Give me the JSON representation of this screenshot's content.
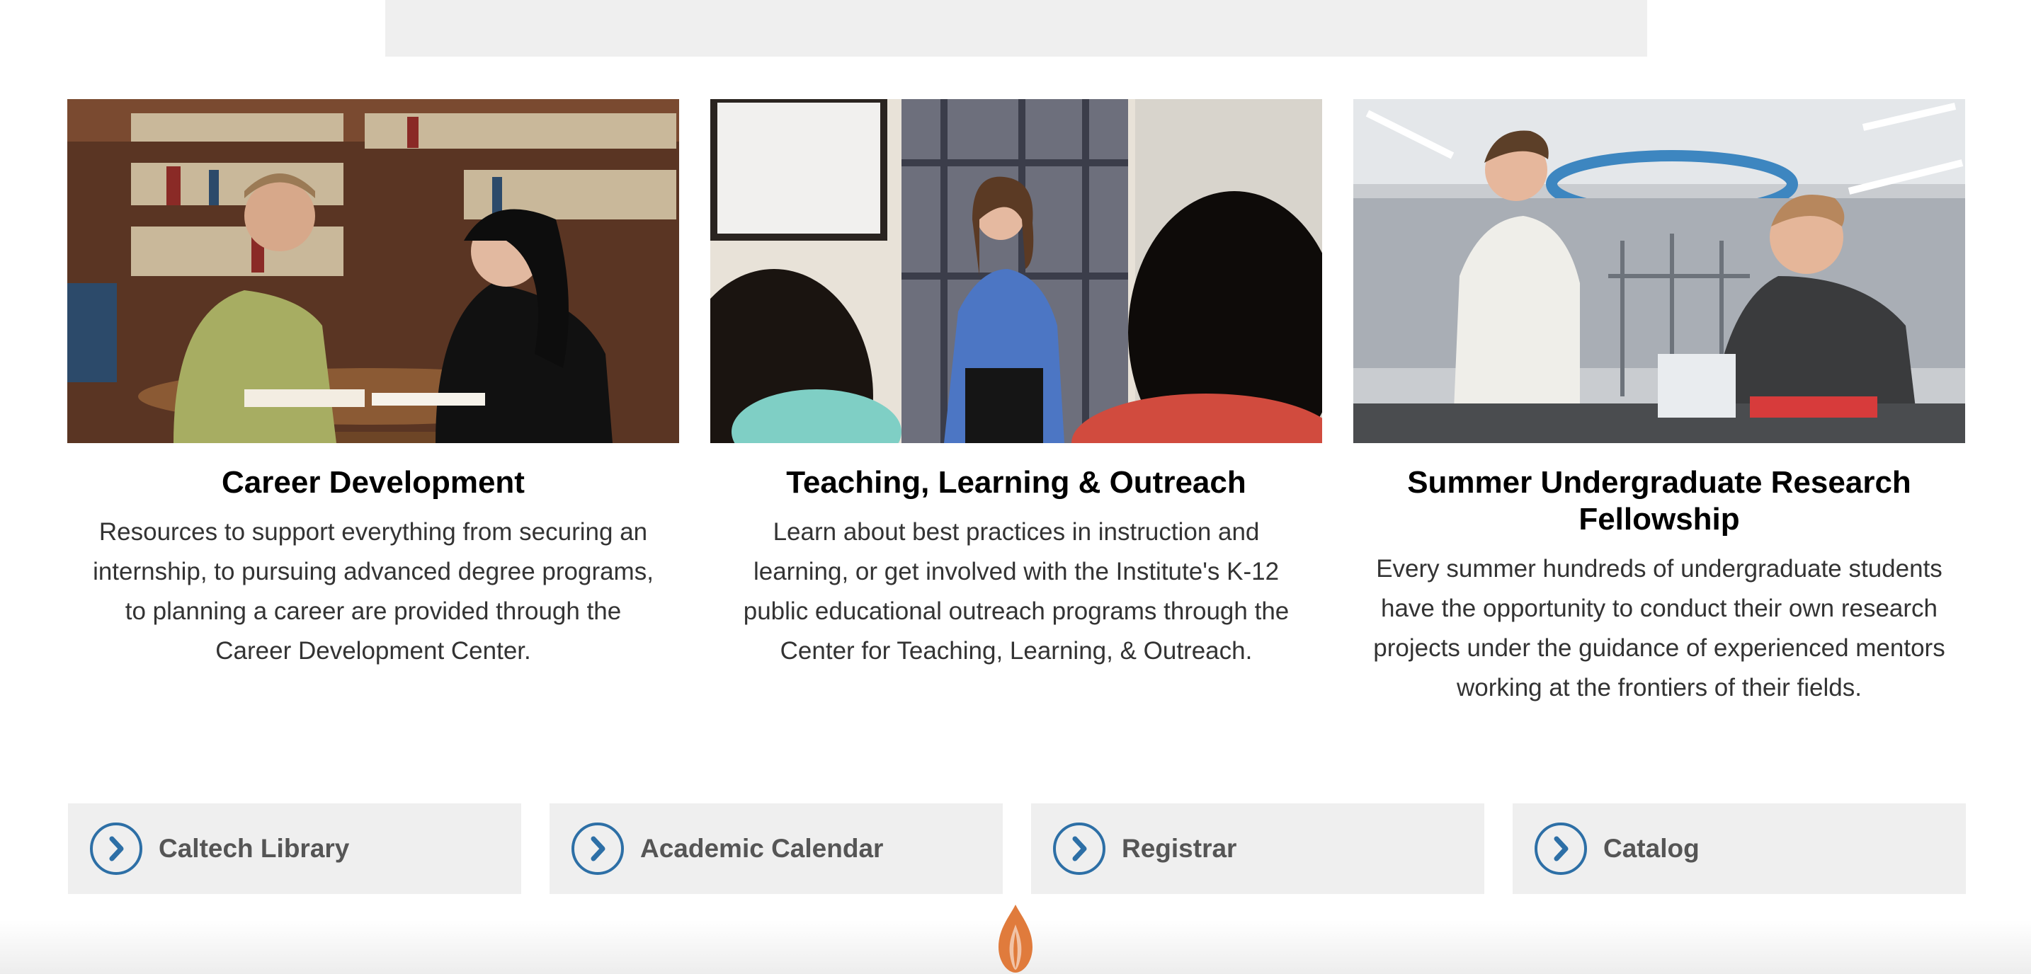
{
  "cards": [
    {
      "title": "Career Development",
      "description": "Resources to support everything from securing an internship, to pursuing advanced degree programs, to planning a career are provided through the Career Development Center."
    },
    {
      "title": "Teaching, Learning & Outreach",
      "description": "Learn about best practices in instruction and learning, or get involved with the Institute's K-12 public educational outreach programs through the Center for Teaching, Learning, & Outreach."
    },
    {
      "title": "Summer Undergraduate Research Fellowship",
      "description": "Every summer hundreds of undergraduate students have the opportunity to conduct their own research projects under the guidance of experienced mentors working at the frontiers of their fields."
    }
  ],
  "links": [
    {
      "label": "Caltech Library",
      "icon": "chevron-right-circle-icon"
    },
    {
      "label": "Academic Calendar",
      "icon": "chevron-right-circle-icon"
    },
    {
      "label": "Registrar",
      "icon": "chevron-right-circle-icon"
    },
    {
      "label": "Catalog",
      "icon": "chevron-right-circle-icon"
    }
  ],
  "colors": {
    "accent": "#2d6fa6",
    "flame": "#e07b3c",
    "box_background": "#efefef"
  }
}
